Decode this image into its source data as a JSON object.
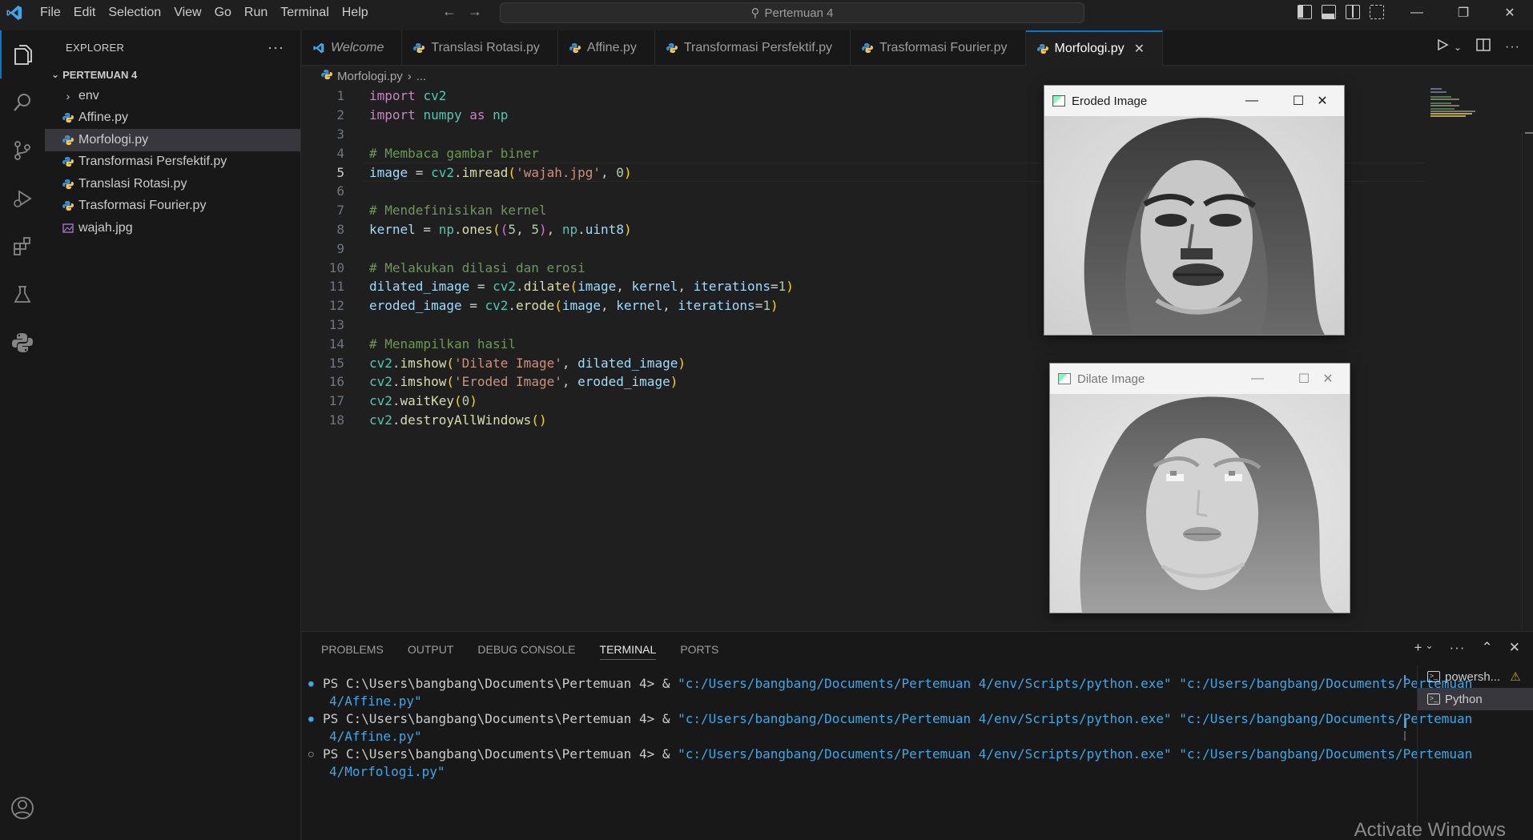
{
  "titlebar": {
    "menus": [
      "File",
      "Edit",
      "Selection",
      "View",
      "Go",
      "Run",
      "Terminal",
      "Help"
    ],
    "search_text": "Pertemuan 4"
  },
  "sidebar": {
    "header": "EXPLORER",
    "folder": "PERTEMUAN 4",
    "items": [
      {
        "label": "env",
        "type": "folder"
      },
      {
        "label": "Affine.py",
        "type": "python"
      },
      {
        "label": "Morfologi.py",
        "type": "python",
        "selected": true
      },
      {
        "label": "Transformasi Persfektif.py",
        "type": "python"
      },
      {
        "label": "Translasi Rotasi.py",
        "type": "python"
      },
      {
        "label": "Trasformasi Fourier.py",
        "type": "python"
      },
      {
        "label": "wajah.jpg",
        "type": "image"
      }
    ]
  },
  "tabs": [
    {
      "label": "Welcome",
      "kind": "vscode"
    },
    {
      "label": "Translasi Rotasi.py",
      "kind": "python"
    },
    {
      "label": "Affine.py",
      "kind": "python"
    },
    {
      "label": "Transformasi Persfektif.py",
      "kind": "python"
    },
    {
      "label": "Trasformasi Fourier.py",
      "kind": "python"
    },
    {
      "label": "Morfologi.py",
      "kind": "python",
      "active": true
    }
  ],
  "breadcrumb": {
    "file": "Morfologi.py",
    "rest": "..."
  },
  "code": {
    "current_line": 5,
    "lines": [
      "import cv2",
      "import numpy as np",
      "",
      "# Membaca gambar biner",
      "image = cv2.imread('wajah.jpg', 0)",
      "",
      "# Mendefinisikan kernel",
      "kernel = np.ones((5, 5), np.uint8)",
      "",
      "# Melakukan dilasi dan erosi",
      "dilated_image = cv2.dilate(image, kernel, iterations=1)",
      "eroded_image = cv2.erode(image, kernel, iterations=1)",
      "",
      "# Menampilkan hasil",
      "cv2.imshow('Dilate Image', dilated_image)",
      "cv2.imshow('Eroded Image', eroded_image)",
      "cv2.waitKey(0)",
      "cv2.destroyAllWindows()"
    ]
  },
  "windows": {
    "eroded": {
      "title": "Eroded Image"
    },
    "dilate": {
      "title": "Dilate Image"
    }
  },
  "panel": {
    "tabs": [
      "PROBLEMS",
      "OUTPUT",
      "DEBUG CONSOLE",
      "TERMINAL",
      "PORTS"
    ],
    "active_tab": "TERMINAL",
    "terminal_lines": [
      {
        "dot": "blue",
        "prompt": "PS C:\\Users\\bangbang\\Documents\\Pertemuan 4> & ",
        "path1": "\"c:/Users/bangbang/Documents/Pertemuan 4/env/Scripts/python.exe\"",
        "path2a": " \"c:/Users/bangbang/Documents/Pertemuan",
        "path2b": "4/Affine.py\""
      },
      {
        "dot": "blue",
        "prompt": "PS C:\\Users\\bangbang\\Documents\\Pertemuan 4> & ",
        "path1": "\"c:/Users/bangbang/Documents/Pertemuan 4/env/Scripts/python.exe\"",
        "path2a": " \"c:/Users/bangbang/Documents/Pertemuan",
        "path2b": "4/Affine.py\""
      },
      {
        "dot": "hollow",
        "prompt": "PS C:\\Users\\bangbang\\Documents\\Pertemuan 4> & ",
        "path1": "\"c:/Users/bangbang/Documents/Pertemuan 4/env/Scripts/python.exe\"",
        "path2a": " \"c:/Users/bangbang/Documents/Pertemuan",
        "path2b": "4/Morfologi.py\""
      }
    ],
    "terminal_list": [
      {
        "label": "powersh...",
        "warning": true
      },
      {
        "label": "Python",
        "selected": true
      }
    ]
  },
  "watermark": "Activate Windows"
}
